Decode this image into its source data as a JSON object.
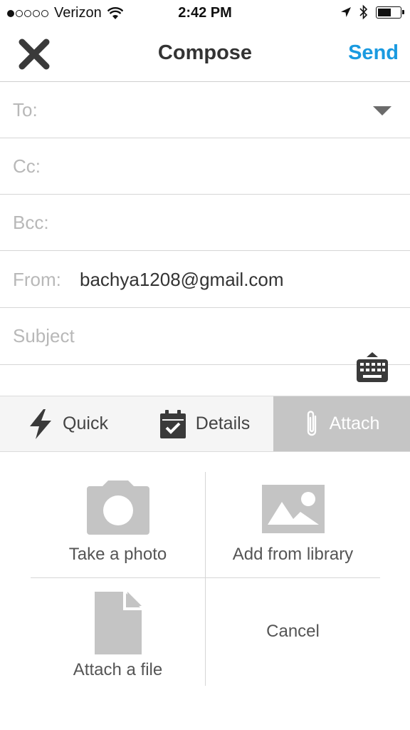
{
  "status_bar": {
    "carrier": "Verizon",
    "time": "2:42 PM",
    "signal_bars_filled": 1,
    "signal_bars_total": 5
  },
  "nav": {
    "title": "Compose",
    "send_label": "Send",
    "close_icon": "close-icon"
  },
  "fields": {
    "to_label": "To:",
    "cc_label": "Cc:",
    "bcc_label": "Bcc:",
    "from_label": "From:",
    "from_value": "bachya1208@gmail.com",
    "subject_placeholder": "Subject"
  },
  "tabs": [
    {
      "label": "Quick",
      "icon": "lightning-icon",
      "active": false
    },
    {
      "label": "Details",
      "icon": "calendar-check-icon",
      "active": false
    },
    {
      "label": "Attach",
      "icon": "paperclip-icon",
      "active": true
    }
  ],
  "attach_options": {
    "take_photo": "Take a photo",
    "add_from_library": "Add from library",
    "attach_file": "Attach a file",
    "cancel": "Cancel"
  },
  "colors": {
    "accent": "#1a9ae0",
    "active_tab": "#c5c5c5",
    "icon_gray": "#c4c4c4"
  }
}
